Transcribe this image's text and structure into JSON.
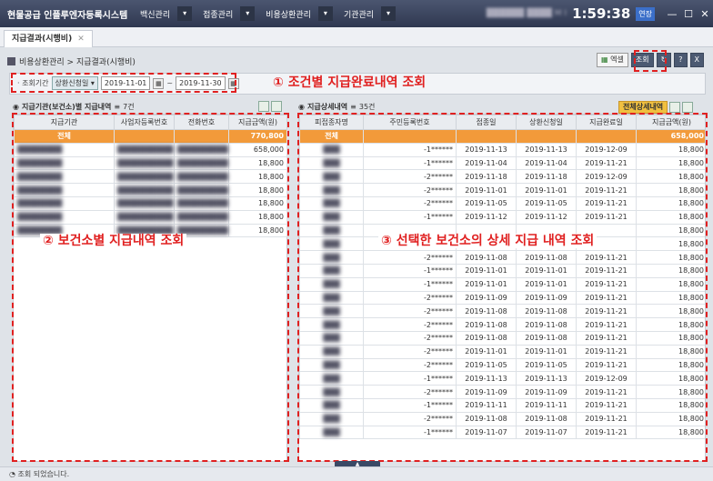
{
  "app_title": "현물공급 인플루엔자등록시스템",
  "menus": [
    "백신관리",
    "접종관리",
    "비용상환관리",
    "기관관리"
  ],
  "user_text": "██████ ████ M I",
  "clock": "1:59:38",
  "extend_label": "연장",
  "tab_label": "지급결과(시행비)",
  "breadcrumb": "비용상환관리 > 지급결과(시행비)",
  "toolbar": {
    "excel": "엑셀",
    "search": "조회",
    "refresh": "↻",
    "help": "?",
    "close": "X"
  },
  "filter": {
    "label": "· 조회기간",
    "select": "상환신청일",
    "from": "2019-11-01",
    "tilde": "~",
    "to": "2019-11-30"
  },
  "annotations": {
    "a1": "① 조건별 지급완료내역 조회",
    "a2": "② 보건소별 지급내역 조회",
    "a3": "③ 선택한 보건소의 상세 지급 내역 조회"
  },
  "left_panel": {
    "title": "지급기관(보건소)별 지급내역",
    "count": "7건",
    "columns": [
      "지급기관",
      "사업자등록번호",
      "전화번호",
      "지급금액(원)"
    ],
    "total": {
      "label": "전체",
      "amount": "770,800"
    },
    "rows": [
      {
        "org": "████████",
        "bizno": "██████████",
        "tel": "██████████",
        "amount": "658,000"
      },
      {
        "org": "████████",
        "bizno": "██████████",
        "tel": "██████████",
        "amount": "18,800"
      },
      {
        "org": "████████",
        "bizno": "██████████",
        "tel": "██████████",
        "amount": "18,800"
      },
      {
        "org": "████████",
        "bizno": "██████████",
        "tel": "██████████",
        "amount": "18,800"
      },
      {
        "org": "████████",
        "bizno": "██████████",
        "tel": "██████████",
        "amount": "18,800"
      },
      {
        "org": "████████",
        "bizno": "██████████",
        "tel": "██████████",
        "amount": "18,800"
      },
      {
        "org": "████████",
        "bizno": "██████████",
        "tel": "██████████",
        "amount": "18,800"
      }
    ]
  },
  "right_panel": {
    "title": "지급상세내역",
    "count": "35건",
    "all_details_button": "전체상세내역",
    "columns": [
      "피접종자명",
      "주민등록번호",
      "접종일",
      "상환신청일",
      "지급완료일",
      "지급금액(원)"
    ],
    "total": {
      "label": "전체",
      "amount": "658,000"
    },
    "rows": [
      {
        "name": "███",
        "rrn": "-1******",
        "vac": "2019-11-13",
        "req": "2019-11-13",
        "paid": "2019-12-09",
        "amount": "18,800"
      },
      {
        "name": "███",
        "rrn": "-1******",
        "vac": "2019-11-04",
        "req": "2019-11-04",
        "paid": "2019-11-21",
        "amount": "18,800"
      },
      {
        "name": "███",
        "rrn": "-2******",
        "vac": "2019-11-18",
        "req": "2019-11-18",
        "paid": "2019-12-09",
        "amount": "18,800"
      },
      {
        "name": "███",
        "rrn": "-2******",
        "vac": "2019-11-01",
        "req": "2019-11-01",
        "paid": "2019-11-21",
        "amount": "18,800"
      },
      {
        "name": "███",
        "rrn": "-2******",
        "vac": "2019-11-05",
        "req": "2019-11-05",
        "paid": "2019-11-21",
        "amount": "18,800"
      },
      {
        "name": "███",
        "rrn": "-1******",
        "vac": "2019-11-12",
        "req": "2019-11-12",
        "paid": "2019-11-21",
        "amount": "18,800"
      },
      {
        "name": "███",
        "rrn": "",
        "vac": "",
        "req": "",
        "paid": "",
        "amount": "18,800"
      },
      {
        "name": "███",
        "rrn": "",
        "vac": "",
        "req": "",
        "paid": "",
        "amount": "18,800"
      },
      {
        "name": "███",
        "rrn": "-2******",
        "vac": "2019-11-08",
        "req": "2019-11-08",
        "paid": "2019-11-21",
        "amount": "18,800"
      },
      {
        "name": "███",
        "rrn": "-1******",
        "vac": "2019-11-01",
        "req": "2019-11-01",
        "paid": "2019-11-21",
        "amount": "18,800"
      },
      {
        "name": "███",
        "rrn": "-1******",
        "vac": "2019-11-01",
        "req": "2019-11-01",
        "paid": "2019-11-21",
        "amount": "18,800"
      },
      {
        "name": "███",
        "rrn": "-2******",
        "vac": "2019-11-09",
        "req": "2019-11-09",
        "paid": "2019-11-21",
        "amount": "18,800"
      },
      {
        "name": "███",
        "rrn": "-2******",
        "vac": "2019-11-08",
        "req": "2019-11-08",
        "paid": "2019-11-21",
        "amount": "18,800"
      },
      {
        "name": "███",
        "rrn": "-2******",
        "vac": "2019-11-08",
        "req": "2019-11-08",
        "paid": "2019-11-21",
        "amount": "18,800"
      },
      {
        "name": "███",
        "rrn": "-2******",
        "vac": "2019-11-08",
        "req": "2019-11-08",
        "paid": "2019-11-21",
        "amount": "18,800"
      },
      {
        "name": "███",
        "rrn": "-2******",
        "vac": "2019-11-01",
        "req": "2019-11-01",
        "paid": "2019-11-21",
        "amount": "18,800"
      },
      {
        "name": "███",
        "rrn": "-2******",
        "vac": "2019-11-05",
        "req": "2019-11-05",
        "paid": "2019-11-21",
        "amount": "18,800"
      },
      {
        "name": "███",
        "rrn": "-1******",
        "vac": "2019-11-13",
        "req": "2019-11-13",
        "paid": "2019-12-09",
        "amount": "18,800"
      },
      {
        "name": "███",
        "rrn": "-2******",
        "vac": "2019-11-09",
        "req": "2019-11-09",
        "paid": "2019-11-21",
        "amount": "18,800"
      },
      {
        "name": "███",
        "rrn": "-1******",
        "vac": "2019-11-11",
        "req": "2019-11-11",
        "paid": "2019-11-21",
        "amount": "18,800"
      },
      {
        "name": "███",
        "rrn": "-2******",
        "vac": "2019-11-08",
        "req": "2019-11-08",
        "paid": "2019-11-21",
        "amount": "18,800"
      },
      {
        "name": "███",
        "rrn": "-1******",
        "vac": "2019-11-07",
        "req": "2019-11-07",
        "paid": "2019-11-21",
        "amount": "18,800"
      }
    ]
  },
  "status": "조회 되었습니다."
}
